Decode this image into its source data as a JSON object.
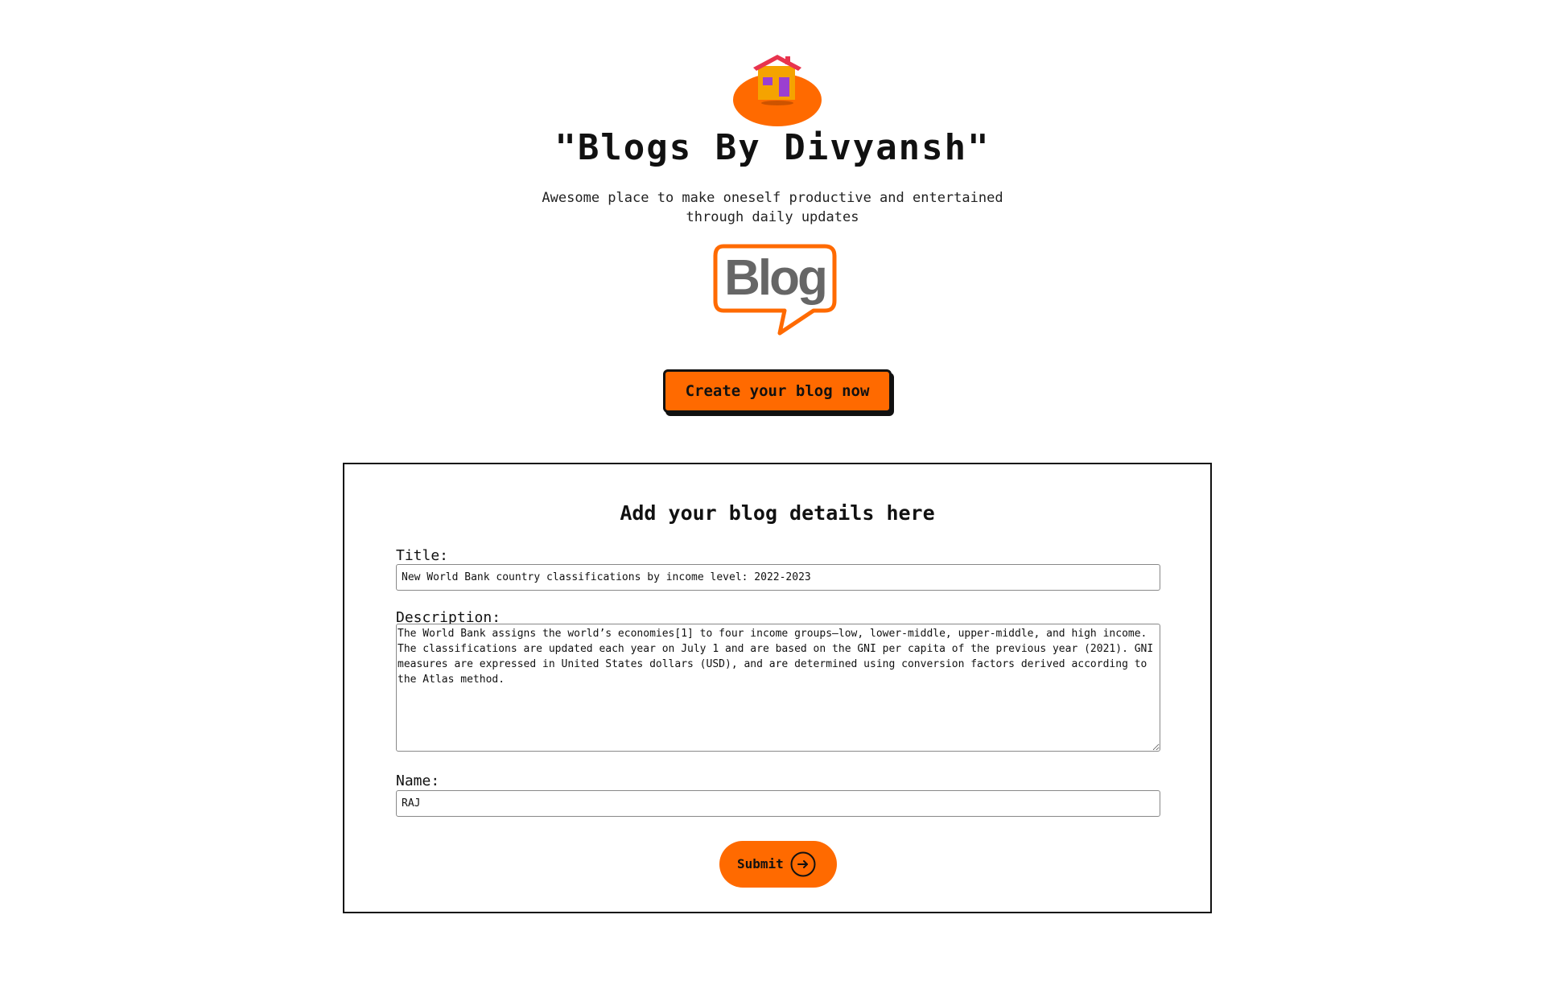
{
  "header": {
    "title": "\"Blogs By Divyansh\"",
    "tagline": "Awesome place to make oneself productive and entertained through daily updates",
    "logo_icon": "house-icon",
    "blog_logo_text": "Blog",
    "create_button_label": "Create your blog now"
  },
  "form": {
    "heading": "Add your blog details here",
    "title_label": "Title:",
    "title_value": "New World Bank country classifications by income level: 2022-2023",
    "description_label": "Description:",
    "description_value": "The World Bank assigns the world’s economies[1] to four income groups—low, lower-middle, upper-middle, and high income. The classifications are updated each year on July 1 and are based on the GNI per capita of the previous year (2021). GNI measures are expressed in United States dollars (USD), and are determined using conversion factors derived according to the Atlas method.",
    "name_label": "Name:",
    "name_value": "RAJ",
    "submit_label": "Submit",
    "submit_icon": "arrow-right-icon"
  },
  "colors": {
    "accent": "#ff6a00",
    "text": "#111111",
    "background": "#ffffff"
  }
}
